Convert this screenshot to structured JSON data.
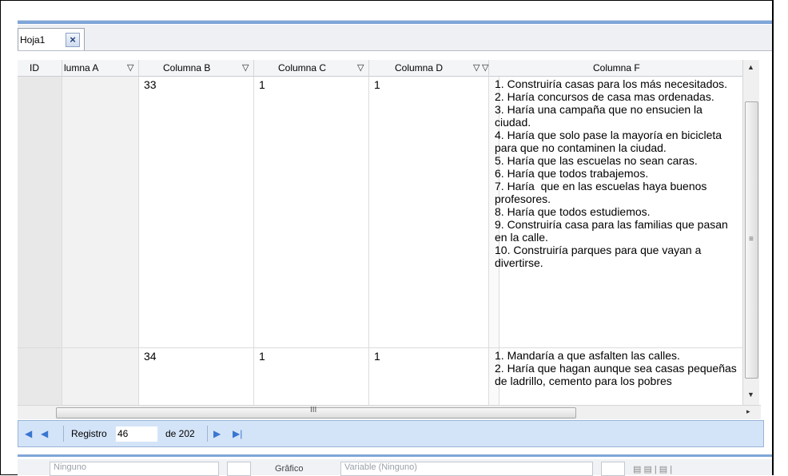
{
  "tabs": [
    {
      "label": "Hoja1"
    }
  ],
  "columns": [
    {
      "label": "ID"
    },
    {
      "label": "lumna A"
    },
    {
      "label": "Columna B"
    },
    {
      "label": "Columna C"
    },
    {
      "label": "Columna D"
    },
    {
      "label": "Columna F"
    }
  ],
  "rows": [
    {
      "b": "33",
      "c": "1",
      "d": "1",
      "f": "1. Construiría casas para los más necesitados.\n2. Haría concursos de casa mas ordenadas.\n3. Haría una campaña que no ensucien la ciudad.\n4. Haría que solo pase la mayoría en bicicleta para que no contaminen la ciudad.\n5. Haría que las escuelas no sean caras.\n6. Haría que todos trabajemos.\n7. Haría  que en las escuelas haya buenos profesores.\n8. Haría que todos estudiemos.\n9. Construiría casa para las familias que pasan en la calle.\n10. Construiría parques para que vayan a divertirse."
    },
    {
      "b": "34",
      "c": "1",
      "d": "1",
      "f": "1. Mandaría a que asfalten las calles.\n2. Haría que hagan aunque sea casas pequeñas de ladrillo, cemento para los pobres"
    }
  ],
  "navigator": {
    "record_label": "Registro",
    "record_value": "46",
    "total_label": "de 202"
  },
  "bottom": {
    "field1_placeholder": "Ninguno",
    "label": "Grâfico",
    "field2_placeholder": "Variable (Ninguno)"
  },
  "colors": {
    "accent": "#7fa6d8",
    "navbar_bg": "#d4e4f8"
  }
}
